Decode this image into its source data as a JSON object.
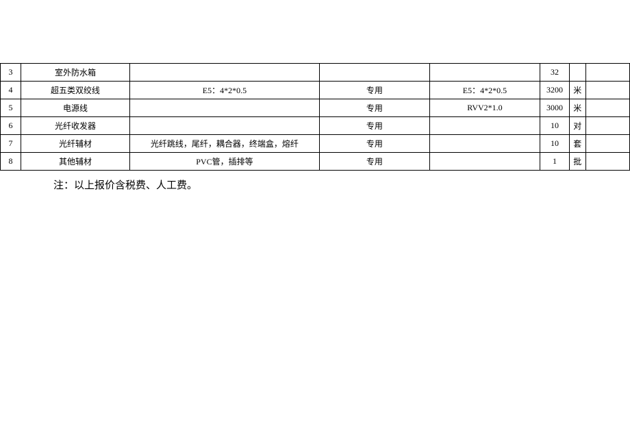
{
  "table": {
    "rows": [
      {
        "idx": "3",
        "name": "室外防水箱",
        "spec": "",
        "use": "",
        "param": "",
        "qty": "32",
        "unit": "",
        "last": ""
      },
      {
        "idx": "4",
        "name": "超五类双绞线",
        "spec": "E5：4*2*0.5",
        "use": "专用",
        "param": "E5：4*2*0.5",
        "qty": "3200",
        "unit": "米",
        "last": ""
      },
      {
        "idx": "5",
        "name": "电源线",
        "spec": "",
        "use": "专用",
        "param": "RVV2*1.0",
        "qty": "3000",
        "unit": "米",
        "last": ""
      },
      {
        "idx": "6",
        "name": "光纤收发器",
        "spec": "",
        "use": "专用",
        "param": "",
        "qty": "10",
        "unit": "对",
        "last": ""
      },
      {
        "idx": "7",
        "name": "光纤辅材",
        "spec": "光纤跳线，尾纤，耦合器，终端盒，熔纤",
        "use": "专用",
        "param": "",
        "qty": "10",
        "unit": "套",
        "last": ""
      },
      {
        "idx": "8",
        "name": "其他辅材",
        "spec": "PVC管，插排等",
        "use": "专用",
        "param": "",
        "qty": "1",
        "unit": "批",
        "last": ""
      }
    ]
  },
  "note": "注：以上报价含税费、人工费。"
}
